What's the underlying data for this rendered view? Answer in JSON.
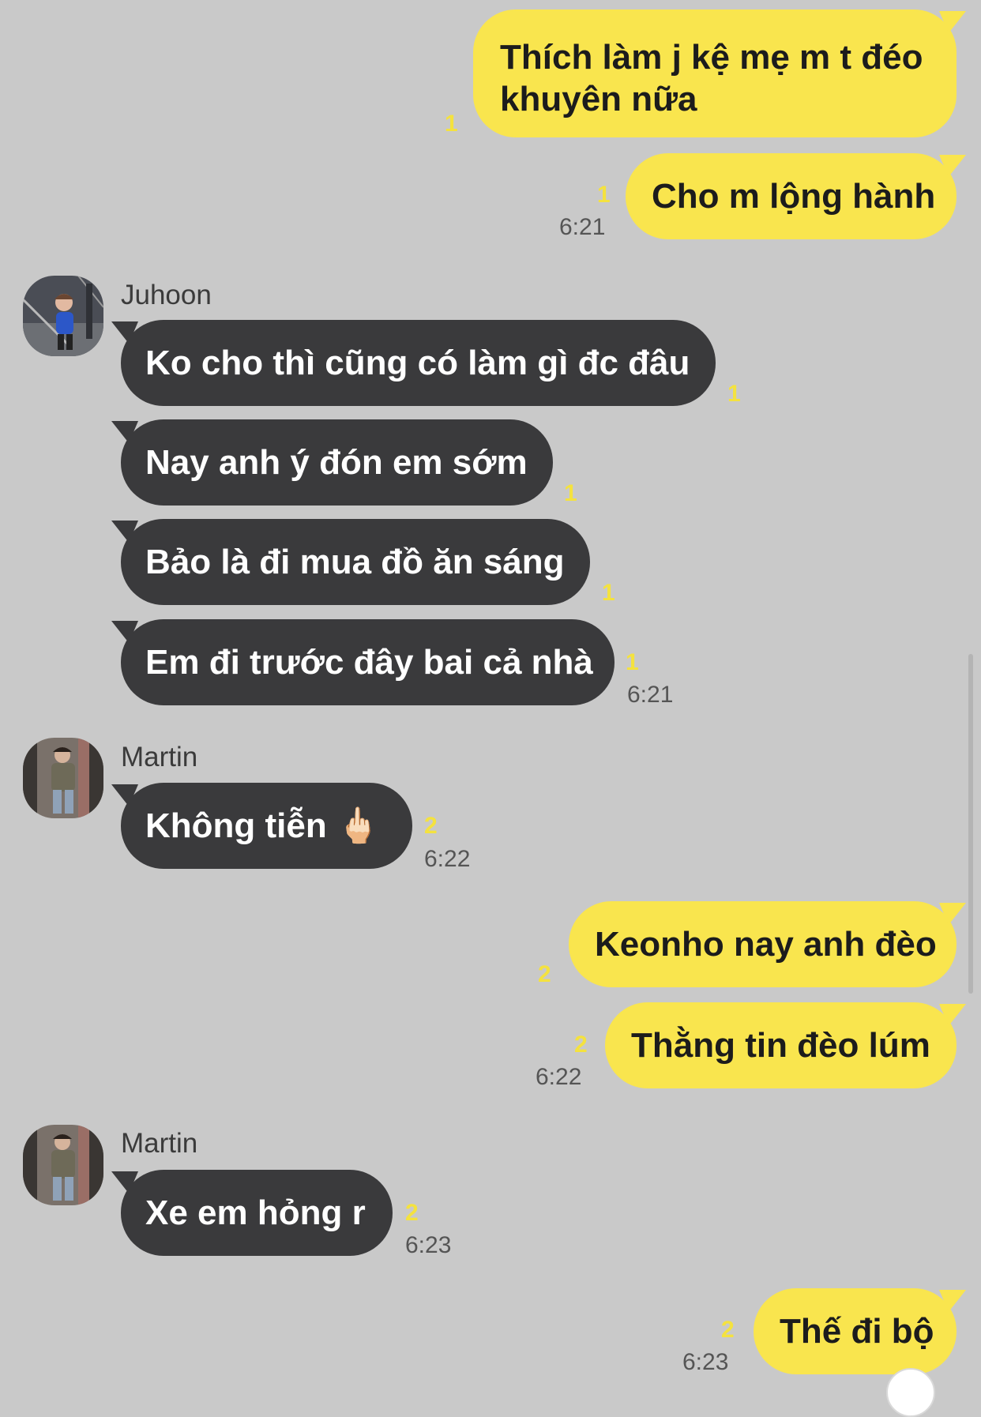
{
  "colors": {
    "background": "#c9c9c9",
    "outgoing_bubble": "#f9e54e",
    "incoming_bubble": "#3a3a3c",
    "unread_count": "#f4e23f",
    "timestamp": "#555555"
  },
  "messages": [
    {
      "direction": "outgoing",
      "lines": [
        "Thích làm j kệ mẹ m t đéo",
        "khuyên nữa"
      ],
      "unread": "1",
      "time": ""
    },
    {
      "direction": "outgoing",
      "lines": [
        "Cho m lộng hành"
      ],
      "unread": "1",
      "time": "6:21"
    },
    {
      "direction": "incoming",
      "sender": "Juhoon",
      "avatar": "juhoon-avatar",
      "lines": [
        "Ko cho thì cũng có làm gì đc đâu"
      ],
      "unread": "1",
      "time": ""
    },
    {
      "direction": "incoming",
      "lines": [
        "Nay anh ý đón em sớm"
      ],
      "unread": "1",
      "time": ""
    },
    {
      "direction": "incoming",
      "lines": [
        "Bảo là đi mua đồ ăn sáng"
      ],
      "unread": "1",
      "time": ""
    },
    {
      "direction": "incoming",
      "lines": [
        "Em đi trước đây bai cả nhà"
      ],
      "unread": "1",
      "time": "6:21"
    },
    {
      "direction": "incoming",
      "sender": "Martin",
      "avatar": "martin-avatar",
      "lines": [
        "Không tiễn 🖕🏻"
      ],
      "unread": "2",
      "time": "6:22"
    },
    {
      "direction": "outgoing",
      "lines": [
        "Keonho nay anh đèo"
      ],
      "unread": "2",
      "time": ""
    },
    {
      "direction": "outgoing",
      "lines": [
        "Thằng tin đèo lúm"
      ],
      "unread": "2",
      "time": "6:22"
    },
    {
      "direction": "incoming",
      "sender": "Martin",
      "avatar": "martin-avatar",
      "lines": [
        "Xe em hỏng r"
      ],
      "unread": "2",
      "time": "6:23"
    },
    {
      "direction": "outgoing",
      "lines": [
        "Thế đi bộ"
      ],
      "unread": "2",
      "time": "6:23"
    }
  ]
}
